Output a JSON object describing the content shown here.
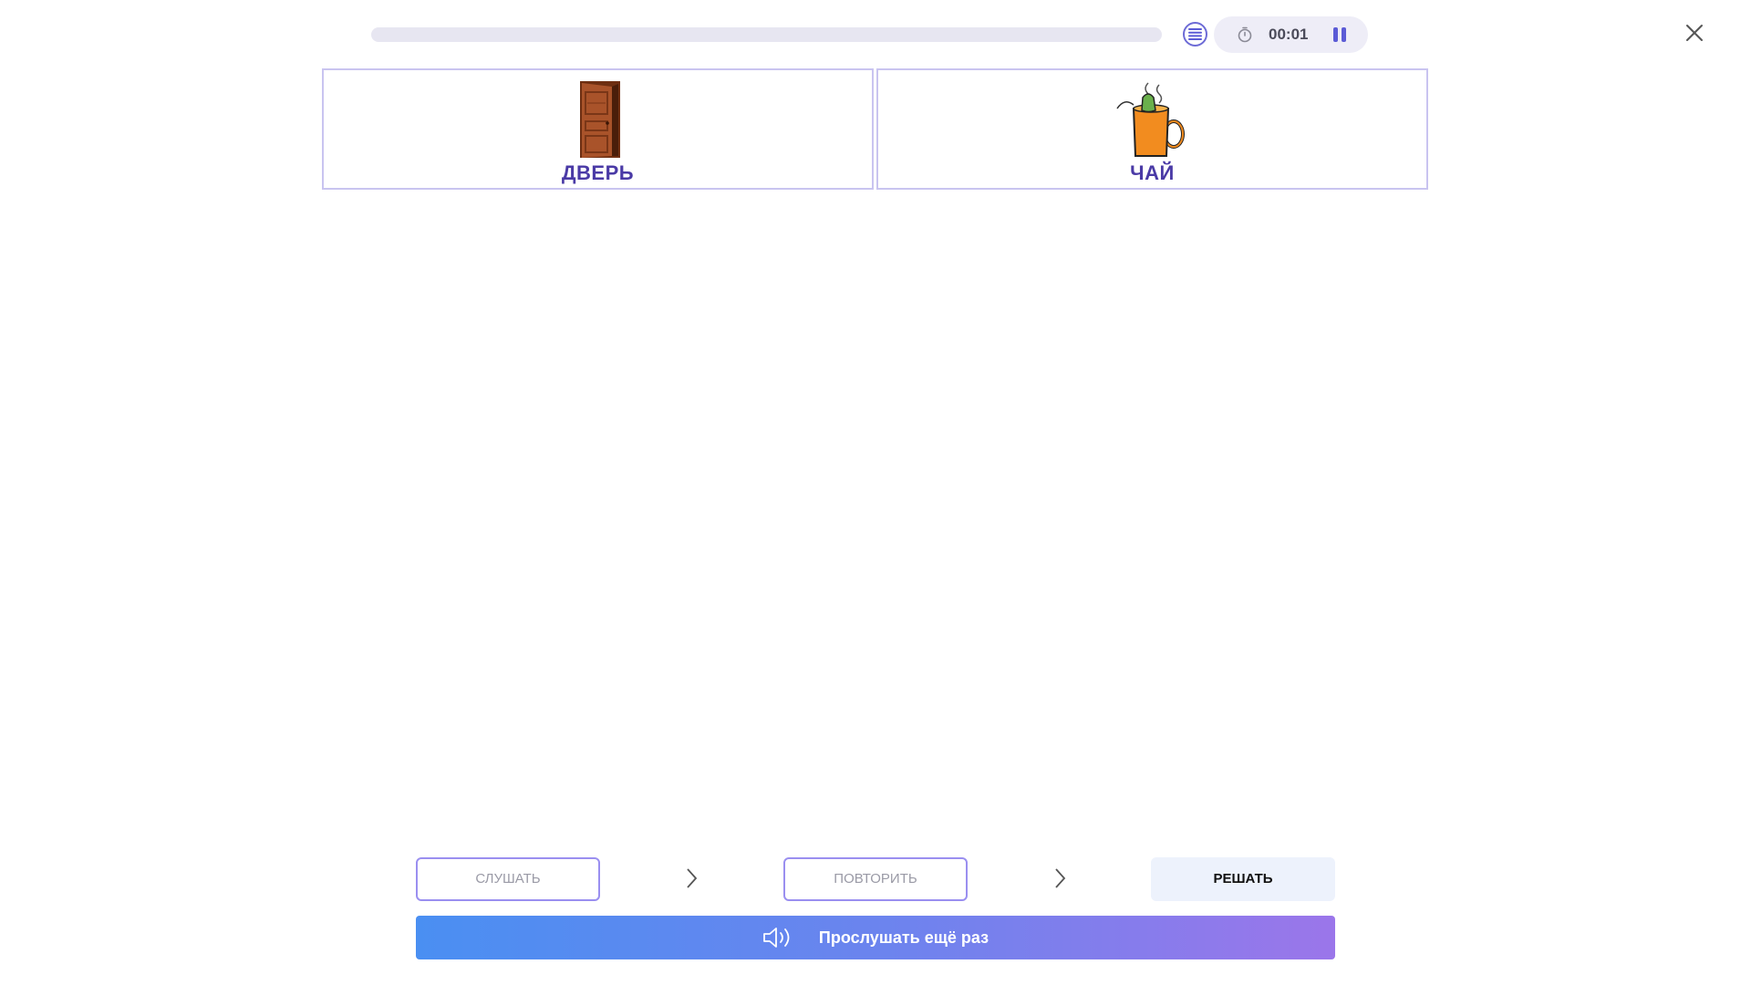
{
  "progress": {
    "value": 0
  },
  "timer": {
    "time": "00:01"
  },
  "icons": {
    "list": "list-icon",
    "timer": "stopwatch-icon",
    "pause": "pause-icon",
    "close": "close-icon",
    "chevron": "chevron-right-icon",
    "speaker": "speaker-icon"
  },
  "cards": [
    {
      "label": "ДВЕРЬ",
      "image": "door"
    },
    {
      "label": "ЧАЙ",
      "image": "tea-mug"
    }
  ],
  "steps": {
    "listen": "СЛУШАТЬ",
    "repeat": "ПОВТОРИТЬ",
    "solve": "РЕШАТЬ"
  },
  "listen_again": {
    "label": "Прослушать ещё раз"
  },
  "colors": {
    "accent": "#5b5bd6",
    "card_label": "#4a3aa6",
    "card_border": "#c9c4f0",
    "gradient_start": "#4a8ff2",
    "gradient_end": "#9b76ea"
  }
}
